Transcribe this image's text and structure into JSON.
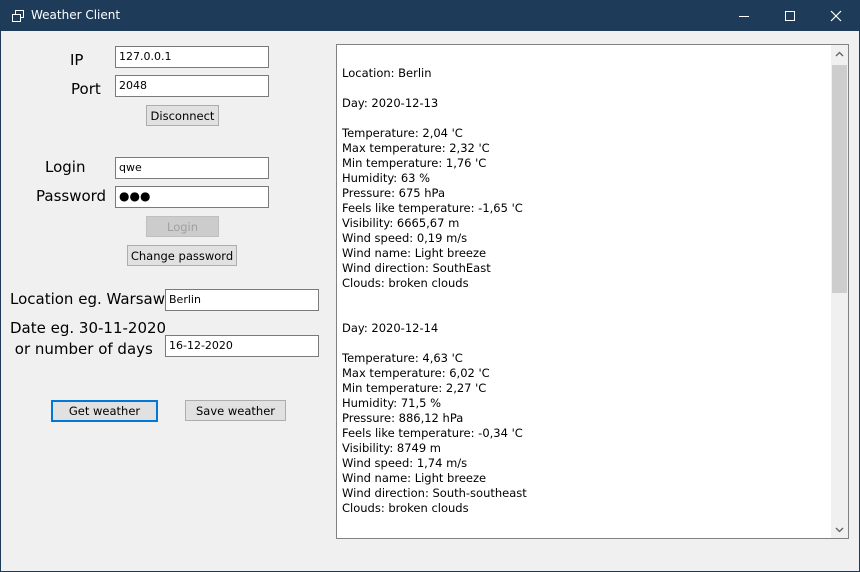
{
  "window": {
    "title": "Weather Client"
  },
  "connection": {
    "ip_label": "IP",
    "ip_value": "127.0.0.1",
    "port_label": "Port",
    "port_value": "2048",
    "disconnect_label": "Disconnect"
  },
  "auth": {
    "login_label": "Login",
    "login_value": "qwe",
    "password_label": "Password",
    "password_value": "●●●",
    "login_button": "Login",
    "change_password_button": "Change password"
  },
  "query": {
    "location_label": "Location eg. Warsaw",
    "location_value": "Berlin",
    "date_label_line1": "Date eg. 30-11-2020",
    "date_label_line2": " or number of days",
    "date_value": "16-12-2020",
    "get_weather_button": "Get weather",
    "save_weather_button": "Save weather"
  },
  "output": {
    "text": "Location: Berlin\n\nDay: 2020-12-13\n\nTemperature: 2,04 'C\nMax temperature: 2,32 'C\nMin temperature: 1,76 'C\nHumidity: 63 %\nPressure: 675 hPa\nFeels like temperature: -1,65 'C\nVisibility: 6665,67 m\nWind speed: 0,19 m/s\nWind name: Light breeze\nWind direction: SouthEast\nClouds: broken clouds\n\n\nDay: 2020-12-14\n\nTemperature: 4,63 'C\nMax temperature: 6,02 'C\nMin temperature: 2,27 'C\nHumidity: 71,5 %\nPressure: 886,12 hPa\nFeels like temperature: -0,34 'C\nVisibility: 8749 m\nWind speed: 1,74 m/s\nWind name: Light breeze\nWind direction: South-southeast\nClouds: broken clouds"
  },
  "icons": {
    "app": "window-icon",
    "minimize": "minimize-icon",
    "maximize": "maximize-icon",
    "close": "close-icon",
    "scroll_up": "chevron-up-icon",
    "scroll_down": "chevron-down-icon"
  },
  "colors": {
    "titlebar": "#1e3b5a",
    "focus": "#0078d7"
  }
}
